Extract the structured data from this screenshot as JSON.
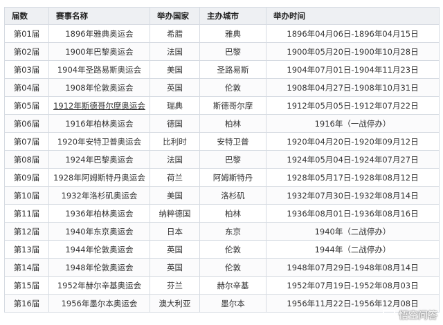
{
  "table": {
    "headers": [
      "届数",
      "赛事名称",
      "举办国家",
      "主办城市",
      "举办时间"
    ],
    "rows": [
      {
        "edition": "第01届",
        "name": "1896年雅典奥运会",
        "country": "希腊",
        "city": "雅典",
        "time": "1896年04月06日-1896年04月15日"
      },
      {
        "edition": "第02届",
        "name": "1900年巴黎奥运会",
        "country": "法国",
        "city": "巴黎",
        "time": "1900年05月20日-1900年10月28日"
      },
      {
        "edition": "第03届",
        "name": "1904年圣路易斯奥运会",
        "country": "美国",
        "city": "圣路易斯",
        "time": "1904年07月01日-1904年11月23日"
      },
      {
        "edition": "第04届",
        "name": "1908年伦敦奥运会",
        "country": "英国",
        "city": "伦敦",
        "time": "1908年04月27日-1908年10月31日"
      },
      {
        "edition": "第05届",
        "name": "1912年斯德哥尔摩奥运会",
        "country": "瑞典",
        "city": "斯德哥尔摩",
        "time": "1912年05月05日-1912年07月22日"
      },
      {
        "edition": "第06届",
        "name": "1916年柏林奥运会",
        "country": "德国",
        "city": "柏林",
        "time": "1916年（一战停办）"
      },
      {
        "edition": "第07届",
        "name": "1920年安特卫普奥运会",
        "country": "比利时",
        "city": "安特卫普",
        "time": "1920年04月20日-1920年09月12日"
      },
      {
        "edition": "第08届",
        "name": "1924年巴黎奥运会",
        "country": "法国",
        "city": "巴黎",
        "time": "1924年05月04日-1924年07月27日"
      },
      {
        "edition": "第09届",
        "name": "1928年阿姆斯特丹奥运会",
        "country": "荷兰",
        "city": "阿姆斯特丹",
        "time": "1928年05月17日-1928年08月12日"
      },
      {
        "edition": "第10届",
        "name": "1932年洛杉矶奥运会",
        "country": "美国",
        "city": "洛杉矶",
        "time": "1932年07月30日-1932年08月14日"
      },
      {
        "edition": "第11届",
        "name": "1936年柏林奥运会",
        "country": "纳粹德国",
        "city": "柏林",
        "time": "1936年08月01日-1936年08月16日"
      },
      {
        "edition": "第12届",
        "name": "1940年东京奥运会",
        "country": "日本",
        "city": "东京",
        "time": "1940年（二战停办）"
      },
      {
        "edition": "第13届",
        "name": "1944年伦敦奥运会",
        "country": "英国",
        "city": "伦敦",
        "time": "1944年（二战停办）"
      },
      {
        "edition": "第14届",
        "name": "1948年伦敦奥运会",
        "country": "英国",
        "city": "伦敦",
        "time": "1948年07月29日-1948年08月14日"
      },
      {
        "edition": "第15届",
        "name": "1952年赫尔辛基奥运会",
        "country": "芬兰",
        "city": "赫尔辛基",
        "time": "1952年07月19日-1952年08月03日"
      },
      {
        "edition": "第16届",
        "name": "1956年墨尔本奥运会",
        "country": "澳大利亚",
        "city": "墨尔本",
        "time": "1956年11月22日-1956年12月08日"
      }
    ]
  },
  "colors": {
    "link": "#2a6db3",
    "header_bg": "#eef0f3",
    "border": "#d6dbe2"
  },
  "watermark": {
    "icon": "chat-bubble-icon",
    "text": "悟空问答"
  }
}
